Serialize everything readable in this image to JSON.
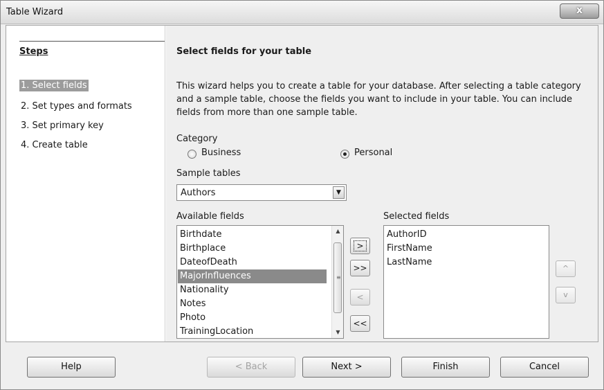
{
  "window": {
    "title": "Table Wizard",
    "close_glyph": "x"
  },
  "steps": {
    "title": "Steps",
    "items": [
      {
        "label": "1. Select fields",
        "active": true
      },
      {
        "label": "2. Set types and formats",
        "active": false
      },
      {
        "label": "3. Set primary key",
        "active": false
      },
      {
        "label": "4. Create table",
        "active": false
      }
    ]
  },
  "page": {
    "heading": "Select fields for your table",
    "description": "This wizard helps you to create a table for your database. After selecting a table category and a sample table, choose the fields you want to include in your table. You can include fields from more than one sample table.",
    "category_label": "Category",
    "category_options": [
      {
        "label": "Business",
        "checked": false
      },
      {
        "label": "Personal",
        "checked": true
      }
    ],
    "sample_tables_label": "Sample tables",
    "sample_table_value": "Authors",
    "available_fields_label": "Available fields",
    "available_fields": [
      "Birthdate",
      "Birthplace",
      "DateofDeath",
      "MajorInfluences",
      "Nationality",
      "Notes",
      "Photo",
      "TrainingLocation"
    ],
    "available_selected": "MajorInfluences",
    "selected_fields_label": "Selected fields",
    "selected_fields": [
      "AuthorID",
      "FirstName",
      "LastName"
    ],
    "move_buttons": [
      ">",
      ">>",
      "<",
      "<<"
    ],
    "order_buttons": [
      "^",
      "v"
    ]
  },
  "buttons": {
    "help": "Help",
    "back": "< Back",
    "next": "Next >",
    "finish": "Finish",
    "cancel": "Cancel"
  }
}
